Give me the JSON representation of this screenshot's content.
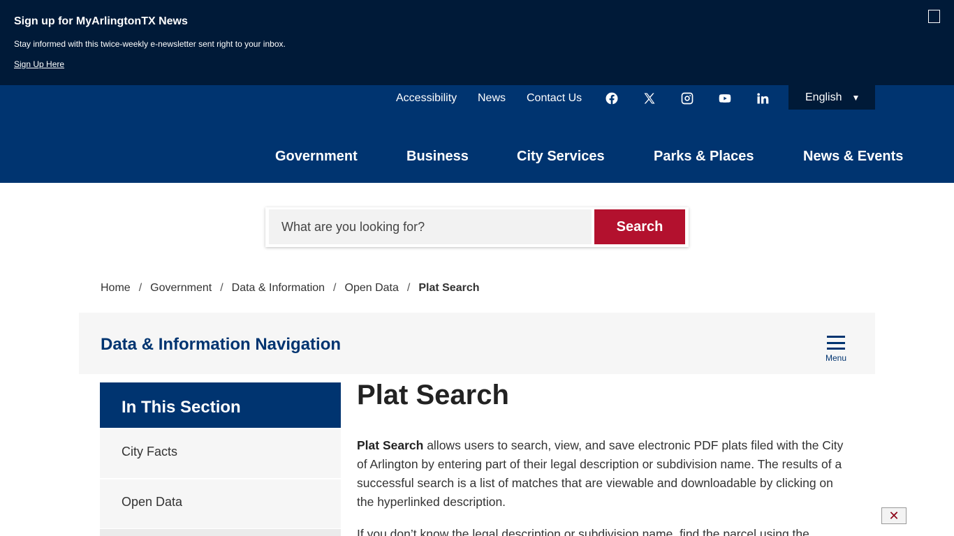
{
  "banner": {
    "title": "Sign up for MyArlingtonTX News",
    "description": "Stay informed with this twice-weekly e-newsletter sent right to your inbox.",
    "link_label": "Sign Up Here"
  },
  "utility_nav": {
    "accessibility": "Accessibility",
    "news": "News",
    "contact": "Contact Us",
    "language": "English",
    "language_caret": "▼"
  },
  "social_icons": [
    "facebook-icon",
    "x-icon",
    "instagram-icon",
    "youtube-icon",
    "linkedin-icon"
  ],
  "main_nav": {
    "government": "Government",
    "business": "Business",
    "city_services": "City Services",
    "parks_places": "Parks & Places",
    "news_events": "News & Events"
  },
  "search": {
    "placeholder": "What are you looking for?",
    "button_label": "Search"
  },
  "breadcrumb": {
    "separator": "/",
    "home": "Home",
    "government": "Government",
    "data_info": "Data & Information",
    "open_data": "Open Data",
    "current": "Plat Search"
  },
  "section_nav": {
    "title": "Data & Information Navigation",
    "menu_label": "Menu"
  },
  "sidebar": {
    "heading": "In This Section",
    "items": [
      "City Facts",
      "Open Data"
    ]
  },
  "content": {
    "title": "Plat Search",
    "intro_bold": "Plat Search",
    "intro_rest": " allows users to search, view, and save electronic PDF plats filed with the City of Arlington by entering part of their legal description or subdivision name. The results of a successful search is a list of matches that are viewable and downloadable by clicking on the hyperlinked description.",
    "second_paragraph": "If you don’t know the legal description or subdivision name, find the parcel using the"
  },
  "float_close_glyph": "✕",
  "colors": {
    "banner_bg": "#001a38",
    "header_bg": "#003470",
    "accent_red": "#b3112e",
    "nav_gray": "#f6f6f6"
  }
}
